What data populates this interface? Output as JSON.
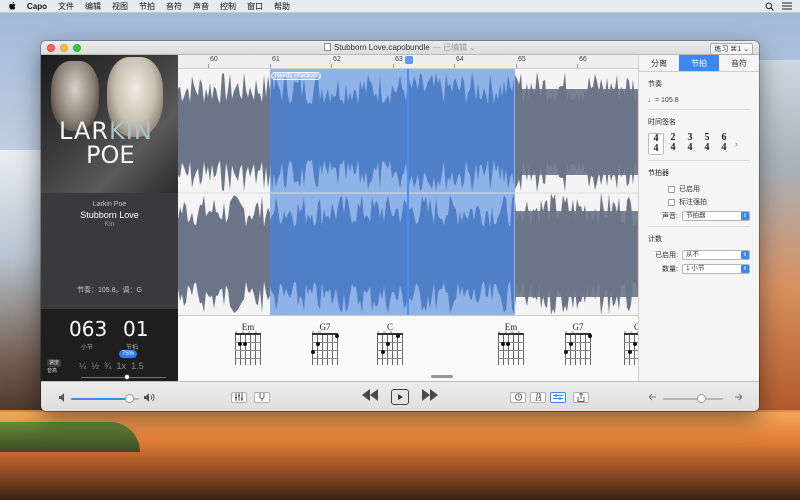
{
  "menubar": {
    "app": "Capo",
    "items": [
      "文件",
      "编辑",
      "视图",
      "节拍",
      "音符",
      "声音",
      "控制",
      "窗口",
      "帮助"
    ]
  },
  "window": {
    "title": "Stubborn Love.capobundle",
    "edited": "— 已编辑 ⌄",
    "practice_button": "练习 ⌘1 ⌄"
  },
  "album": {
    "logo_line1_a": "LAR",
    "logo_line1_b": "KIN",
    "logo_line2": "POE"
  },
  "song": {
    "artist": "Larkin Poe",
    "title": "Stubborn Love",
    "album": "Kin",
    "meta": "节奏：105.8。调：G"
  },
  "counter": {
    "bar": "063",
    "bar_caption": "小节",
    "beat": "01",
    "beat_caption": "节拍",
    "speed_label": "速度",
    "pitch_label": "音高",
    "speed_marks": [
      "¼",
      "½",
      "¾",
      "1x",
      "1.5"
    ],
    "speed_value": "75%",
    "speed_level": 0.75
  },
  "ruler": {
    "labels": [
      "60",
      "61",
      "62",
      "63",
      "64",
      "65",
      "66"
    ],
    "playhead_bar": "63"
  },
  "region": {
    "label": "Needs Practice!"
  },
  "chords": [
    {
      "name": "Em",
      "marks": "o  o o o"
    },
    {
      "name": "G7",
      "marks": "     o o"
    },
    {
      "name": "C",
      "marks": "x    o o"
    },
    {
      "name": "Em",
      "marks": "o  o o o"
    },
    {
      "name": "G7",
      "marks": "     o o"
    },
    {
      "name": "C",
      "marks": "x    o o"
    }
  ],
  "inspector": {
    "tabs": [
      "分离",
      "节拍",
      "音符"
    ],
    "active_tab": "节拍",
    "tempo_title": "节奏",
    "tempo_value": "♩= 105.8",
    "timesig_title": "时间签名",
    "timesigs": [
      {
        "top": "4",
        "bottom": "4"
      },
      {
        "top": "2",
        "bottom": "4"
      },
      {
        "top": "3",
        "bottom": "4"
      },
      {
        "top": "5",
        "bottom": "4"
      },
      {
        "top": "6",
        "bottom": "4"
      }
    ],
    "metronome_title": "节拍器",
    "metronome_enabled": "已启用",
    "metronome_accent": "标注强拍",
    "sound_label": "声音:",
    "sound_value": "节拍器",
    "countin_title": "计数",
    "countin_enabled_label": "已启用:",
    "countin_enabled_value": "从不",
    "countin_count_label": "数量:",
    "countin_count_value": "1 小节"
  },
  "toolbar": {
    "volume_level": 0.85,
    "pan_level": 0.5
  },
  "colors": {
    "accent": "#3b88f5",
    "region": "#8fb3e6",
    "waveform": "#6b7587"
  }
}
